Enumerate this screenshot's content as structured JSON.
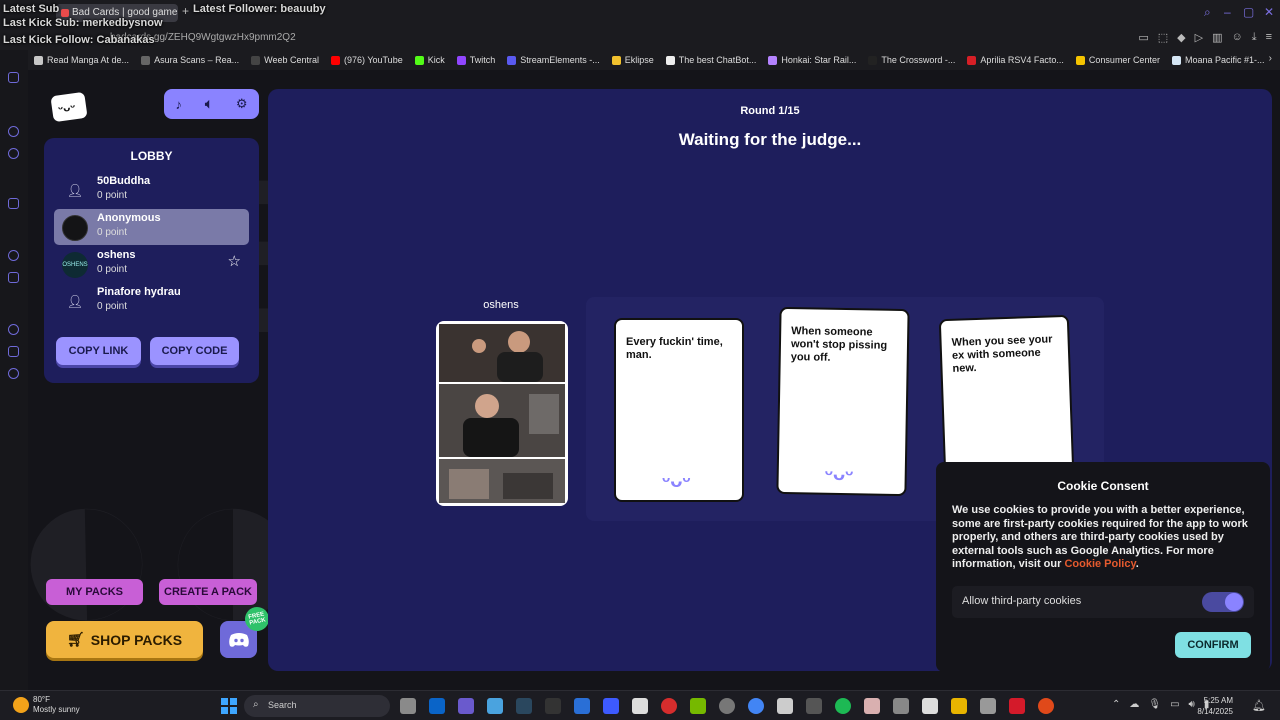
{
  "overlay": {
    "latest_sub": "Latest Sub",
    "latest_follower": "Latest Follower: beauuby",
    "kick_sub": "Last Kick Sub: merkedbysnow",
    "kick_follow": "Last Kick Follow: Cabanakas"
  },
  "browser": {
    "tab_title": "Bad Cards | good games",
    "url": "badcards.gg/ZEHQ9WgtgwzHx9pmm2Q2",
    "bookmarks": [
      {
        "label": "Read Manga At de...",
        "color": "#c8c8c8"
      },
      {
        "label": "Asura Scans – Rea...",
        "color": "#666666"
      },
      {
        "label": "Weeb Central",
        "color": "#444444"
      },
      {
        "label": "(976) YouTube",
        "color": "#ff0000"
      },
      {
        "label": "Kick",
        "color": "#53fc18"
      },
      {
        "label": "Twitch",
        "color": "#9146ff"
      },
      {
        "label": "StreamElements -...",
        "color": "#5a5af0"
      },
      {
        "label": "Eklipse",
        "color": "#f2c12e"
      },
      {
        "label": "The best ChatBot...",
        "color": "#eeeeee"
      },
      {
        "label": "Honkai: Star Rail...",
        "color": "#b583ff"
      },
      {
        "label": "The Crossword -...",
        "color": "#222222"
      },
      {
        "label": "Aprilia RSV4 Facto...",
        "color": "#d61f26"
      },
      {
        "label": "Consumer Center",
        "color": "#f5c400"
      },
      {
        "label": "Moana Pacific #1-...",
        "color": "#d6e7f5"
      }
    ]
  },
  "sidebar": {
    "lobby_title": "LOBBY",
    "players": [
      {
        "name": "50Buddha",
        "points": "0 point"
      },
      {
        "name": "Anonymous",
        "points": "0 point"
      },
      {
        "name": "oshens",
        "points": "0 point",
        "avatar_text": "OSHENS"
      },
      {
        "name": "Pinafore hydrau",
        "points": "0 point"
      }
    ],
    "copy_link": "COPY LINK",
    "copy_code": "COPY CODE",
    "my_packs": "MY PACKS",
    "create_pack": "CREATE A PACK",
    "shop_packs": "SHOP PACKS",
    "free_badge": "FREE PACK"
  },
  "game": {
    "round": "Round 1/15",
    "status": "Waiting for the judge...",
    "prompt_owner": "oshens",
    "answers": [
      "Every fuckin' time, man.",
      "When someone won't stop pissing you off.",
      "When you see your ex with someone new."
    ]
  },
  "cookie": {
    "title": "Cookie Consent",
    "body": "We use cookies to provide you with a better experience, some are first-party cookies required for the app to work properly, and others are third-party cookies used by external tools such as Google Analytics. For more information, visit our ",
    "link": "Cookie Policy",
    "body_end": ".",
    "toggle_label": "Allow third-party cookies",
    "toggle_on": true,
    "confirm": "CONFIRM"
  },
  "taskbar": {
    "temp": "80°F",
    "weather": "Mostly sunny",
    "search": "Search",
    "time": "5:25 AM",
    "date": "8/14/2025"
  }
}
